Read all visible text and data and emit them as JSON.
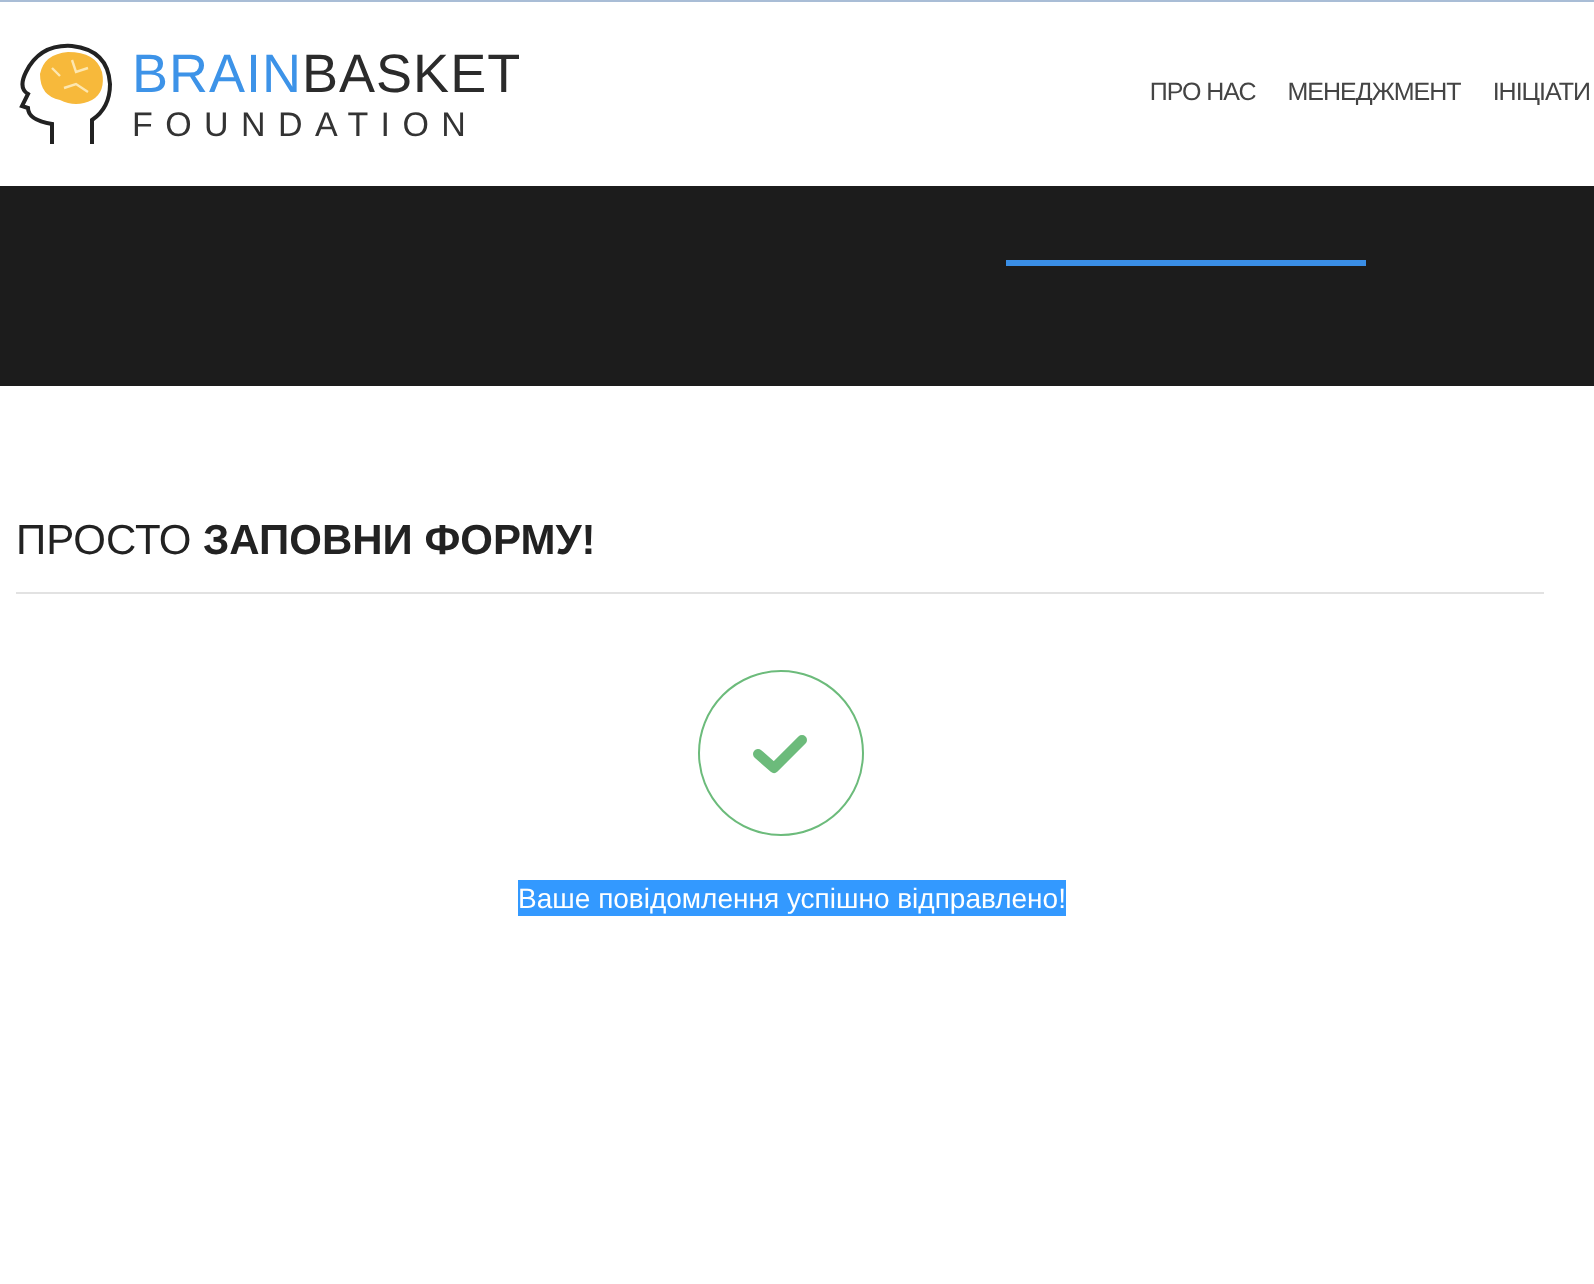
{
  "header": {
    "logo": {
      "word_1": "BRAIN",
      "word_2": "BASKET",
      "subtitle": "FOUNDATION"
    },
    "nav": [
      {
        "label": "ПРО НАС"
      },
      {
        "label": "МЕНЕДЖМЕНТ"
      },
      {
        "label": "ІНІЦІАТИ"
      }
    ]
  },
  "form_section": {
    "heading": "ПРОСТО **ЗАПОВНИ ФОРМУ!**",
    "success_message": "Ваше повідомлення успішно відправлено!"
  }
}
